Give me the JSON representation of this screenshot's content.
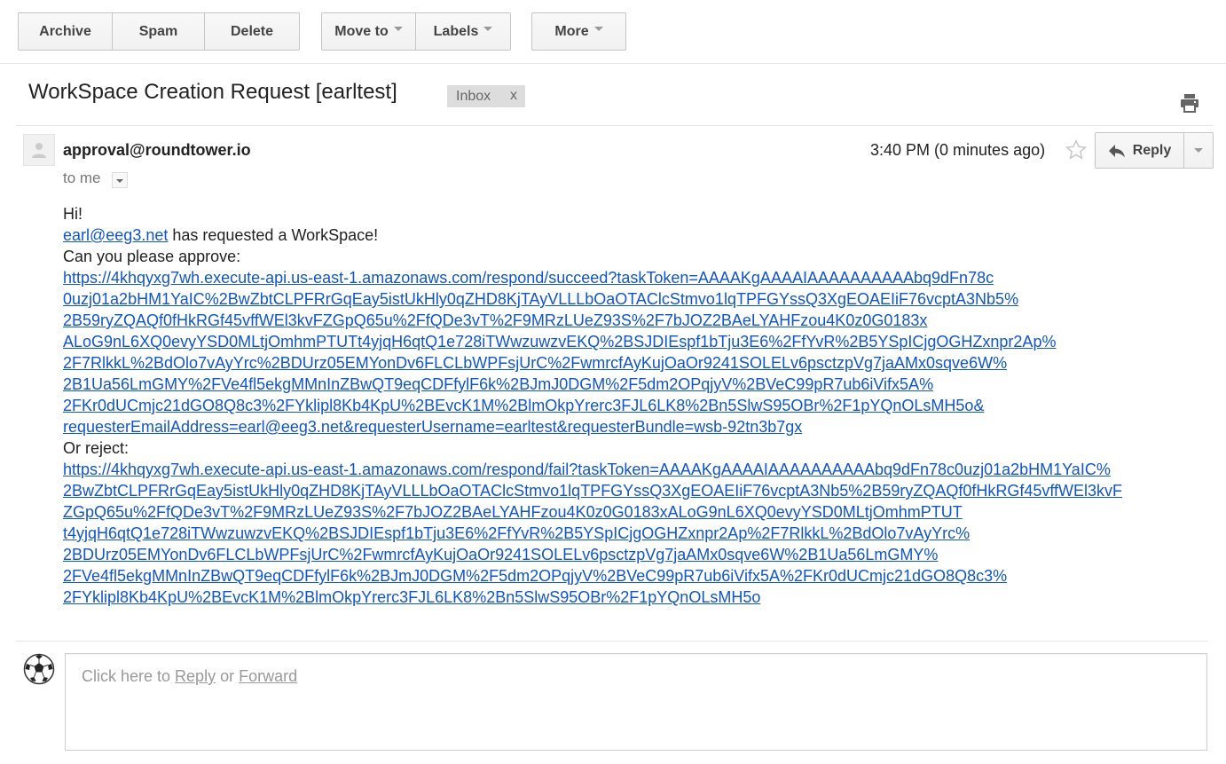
{
  "toolbar": {
    "archive": "Archive",
    "spam": "Spam",
    "delete": "Delete",
    "move_to": "Move to",
    "labels": "Labels",
    "more": "More"
  },
  "subject": {
    "title": "WorkSpace Creation Request [earltest]",
    "label": "Inbox",
    "label_remove": "x"
  },
  "message": {
    "sender": "approval@roundtower.io",
    "to": "to me",
    "time": "3:40 PM (0 minutes ago)",
    "reply_label": "Reply",
    "body": {
      "greeting": "Hi!",
      "requester_email": "earl@eeg3.net",
      "requested_text": " has requested a WorkSpace!",
      "approve_prompt": "Can you please approve:",
      "approve_link_lines": [
        "https://4khqyxg7wh.execute-api.us-east-1.amazonaws.com/respond/succeed?taskToken=AAAAKgAAAAIAAAAAAAAAAbq9dFn78c",
        "0uzj01a2bHM1YaIC%2BwZbtCLPFRrGqEay5istUkHly0qZHD8KjTAyVLLLbOaOTAClcStmvo1lqTPFGYssQ3XgEOAEIiF76vcptA3Nb5%",
        "2B59ryZQAQf0fHkRGf45vffWEl3kvFZGpQ65u%2FfQDe3vT%2F9MRzLUeZ93S%2F7bJOZ2BAeLYAHFzou4K0z0G0183x",
        "ALoG9nL6XQ0evyYSD0MLtjOmhmPTUTt4yjqH6qtQ1e728iTWwzuwzvEKQ%2BSJDIEspf1bTju3E6%2FfYvR%2B5YSpICjgOGHZxnpr2Ap%",
        "2F7RlkkL%2BdOlo7vAyYrc%2BDUrz05EMYonDv6FLCLbWPFsjUrC%2FwmrcfAyKujOaOr9241SOLELv6psctzpVg7jaAMx0sqve6W%",
        "2B1Ua56LmGMY%2FVe4fl5ekgMMnInZBwQT9eqCDFfylF6k%2BJmJ0DGM%2F5dm2OPqjyV%2BVeC99pR7ub6iVifx5A%",
        "2FKr0dUCmjc21dGO8Q8c3%2FYklipl8Kb4KpU%2BEvcK1M%2BlmOkpYrerc3FJL6LK8%2Bn5SlwS95OBr%2F1pYQnOLsMH5o&",
        "requesterEmailAddress=earl@eeg3.net&requesterUsername=earltest&requesterBundle=wsb-92tn3b7gx"
      ],
      "reject_prompt": "Or reject:",
      "reject_link_lines": [
        "https://4khqyxg7wh.execute-api.us-east-1.amazonaws.com/respond/fail?taskToken=AAAAKgAAAAIAAAAAAAAAAbq9dFn78c0uzj01a2bHM1YaIC%",
        "2BwZbtCLPFRrGqEay5istUkHly0qZHD8KjTAyVLLLbOaOTAClcStmvo1lqTPFGYssQ3XgEOAEIiF76vcptA3Nb5%2B59ryZQAQf0fHkRGf45vffWEl3kvF",
        "ZGpQ65u%2FfQDe3vT%2F9MRzLUeZ93S%2F7bJOZ2BAeLYAHFzou4K0z0G0183xALoG9nL6XQ0evyYSD0MLtjOmhmPTUT",
        "t4yjqH6qtQ1e728iTWwzuwzvEKQ%2BSJDIEspf1bTju3E6%2FfYvR%2B5YSpICjgOGHZxnpr2Ap%2F7RlkkL%2BdOlo7vAyYrc%",
        "2BDUrz05EMYonDv6FLCLbWPFsjUrC%2FwmrcfAyKujOaOr9241SOLELv6psctzpVg7jaAMx0sqve6W%2B1Ua56LmGMY%",
        "2FVe4fl5ekgMMnInZBwQT9eqCDFfylF6k%2BJmJ0DGM%2F5dm2OPqjyV%2BVeC99pR7ub6iVifx5A%2FKr0dUCmjc21dGO8Q8c3%",
        "2FYklipl8Kb4KpU%2BEvcK1M%2BlmOkpYrerc3FJL6LK8%2Bn5SlwS95OBr%2F1pYQnOLsMH5o"
      ]
    }
  },
  "reply_box": {
    "prefix": "Click here to ",
    "reply_link": "Reply",
    "or": " or ",
    "forward_link": "Forward"
  },
  "icons": {
    "print": "print-icon",
    "star": "star-icon",
    "reply": "reply-arrow-icon",
    "sender_avatar": "default-person-icon",
    "me_avatar": "soccer-ball-icon"
  },
  "colors": {
    "link": "#1155cc",
    "label_chip_bg": "#dddddd",
    "button_border": "#c6c6c6"
  }
}
